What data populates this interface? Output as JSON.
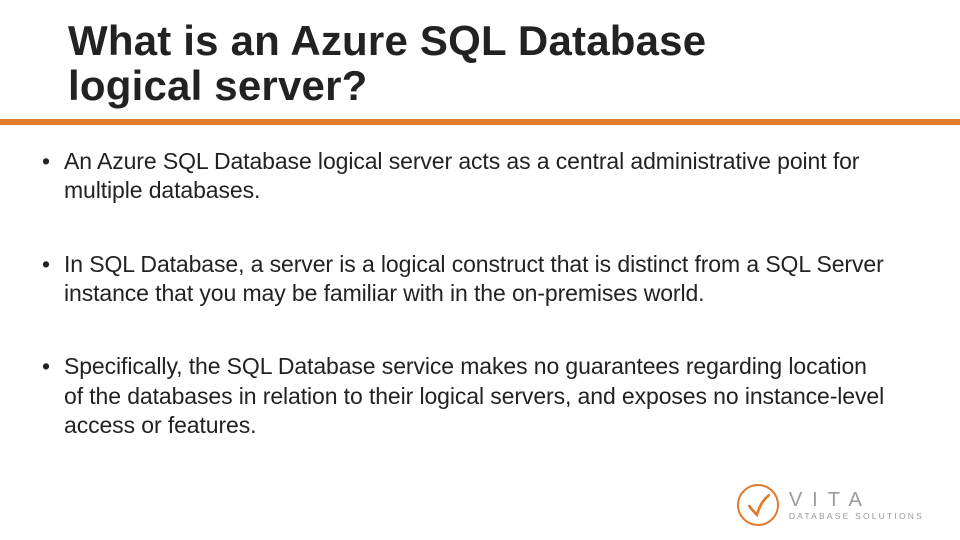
{
  "title": "What is an Azure SQL Database logical server?",
  "bullets": [
    "An Azure SQL Database logical server acts as a central administrative point for multiple databases.",
    "In SQL Database, a server is a logical construct that is distinct from a SQL Server instance that you may be familiar with in the on-premises world.",
    "Specifically, the SQL Database service makes no guarantees regarding location of the databases in relation to their logical servers, and exposes no instance-level access or features."
  ],
  "logo": {
    "brand": "VITA",
    "sub": "DATABASE SOLUTIONS"
  },
  "colors": {
    "accent": "#e07b2e"
  }
}
